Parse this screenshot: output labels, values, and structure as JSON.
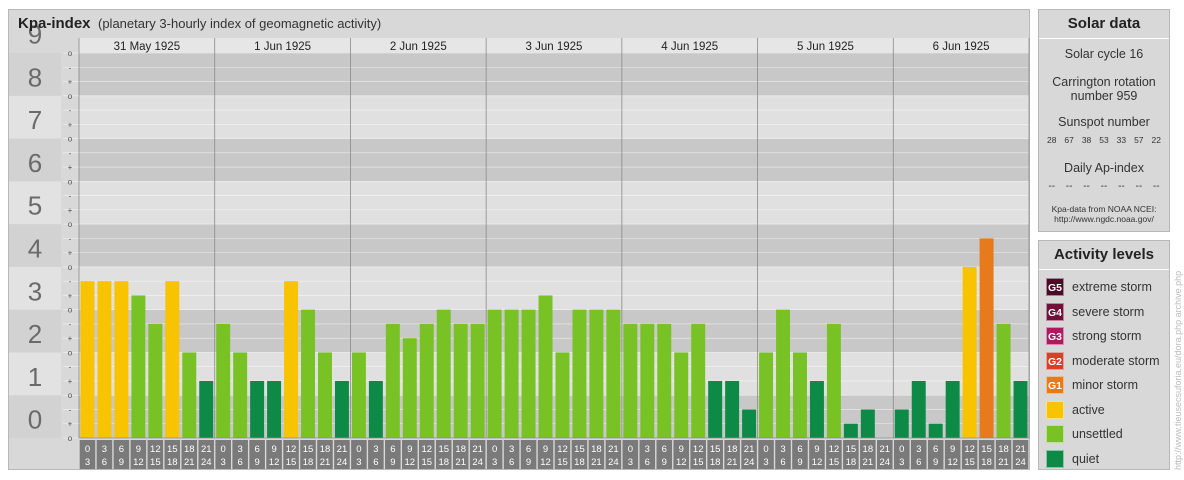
{
  "header": {
    "title": "Kpa-index",
    "subtitle": "(planetary 3-hourly index of geomagnetic activity)"
  },
  "chart_data": {
    "type": "bar",
    "ylim": [
      0,
      9
    ],
    "y_tick_labels": [
      "0",
      "1",
      "2",
      "3",
      "4",
      "5",
      "6",
      "7",
      "8",
      "9"
    ],
    "y_minor_labels": [
      "o",
      "+",
      "-"
    ],
    "days": [
      "31 May 1925",
      "1 Jun 1925",
      "2 Jun 1925",
      "3 Jun 1925",
      "4 Jun 1925",
      "5 Jun 1925",
      "6 Jun 1925"
    ],
    "time_slot_top": [
      "0",
      "3",
      "6",
      "9",
      "12",
      "15",
      "18",
      "21"
    ],
    "time_slot_bottom": [
      "3",
      "6",
      "9",
      "12",
      "15",
      "18",
      "21",
      "24"
    ],
    "values": [
      [
        3.667,
        3.667,
        3.667,
        3.333,
        2.667,
        3.667,
        2.0,
        1.333
      ],
      [
        2.667,
        2.0,
        1.333,
        1.333,
        3.667,
        3.0,
        2.0,
        1.333
      ],
      [
        2.0,
        1.333,
        2.667,
        2.333,
        2.667,
        3.0,
        2.667,
        2.667
      ],
      [
        3.0,
        3.0,
        3.0,
        3.333,
        2.0,
        3.0,
        3.0,
        3.0
      ],
      [
        2.667,
        2.667,
        2.667,
        2.0,
        2.667,
        1.333,
        1.333,
        0.667
      ],
      [
        2.0,
        3.0,
        2.0,
        1.333,
        2.667,
        0.333,
        0.667,
        0.0
      ],
      [
        0.667,
        1.333,
        0.333,
        1.333,
        4.0,
        4.667,
        2.667,
        1.333
      ]
    ],
    "colors": {
      "quiet": "#0d8a45",
      "unsettled": "#79c225",
      "active": "#f8c300",
      "minor_storm": "#e77a1a",
      "band_dark": "#c8c8c8",
      "band_light": "#e0e0e0",
      "axis_number": "#6a6a6a"
    }
  },
  "solar": {
    "title": "Solar data",
    "cycle": "Solar cycle 16",
    "carrington_line1": "Carrington rotation",
    "carrington_line2": "number 959",
    "sunspot_label": "Sunspot number",
    "sunspot_values": [
      "28",
      "67",
      "38",
      "53",
      "33",
      "57",
      "22"
    ],
    "ap_label": "Daily Ap-index",
    "ap_values": [
      "--",
      "--",
      "--",
      "--",
      "--",
      "--",
      "--"
    ],
    "source_line1": "Kpa-data from NOAA NCEI:",
    "source_line2": "http://www.ngdc.noaa.gov/"
  },
  "levels": {
    "title": "Activity levels",
    "items": [
      {
        "code": "G5",
        "label": "extreme storm",
        "color": "#4a0a28"
      },
      {
        "code": "G4",
        "label": "severe storm",
        "color": "#72103a"
      },
      {
        "code": "G3",
        "label": "strong storm",
        "color": "#b01860"
      },
      {
        "code": "G2",
        "label": "moderate storm",
        "color": "#d8402a"
      },
      {
        "code": "G1",
        "label": "minor storm",
        "color": "#e77a1a"
      },
      {
        "code": "",
        "label": "active",
        "color": "#f8c300"
      },
      {
        "code": "",
        "label": "unsettled",
        "color": "#79c225"
      },
      {
        "code": "",
        "label": "quiet",
        "color": "#0d8a45"
      }
    ]
  },
  "watermark": "http://www.tieusecsuforia.eu/dora.php archive.php"
}
